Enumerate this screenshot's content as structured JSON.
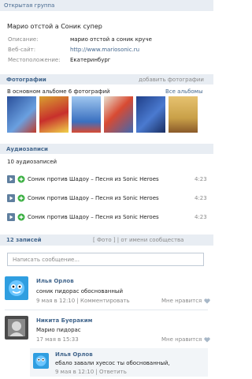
{
  "group_status": "Открытая группа",
  "group_name": "Марио отстой а Соник супер",
  "info": [
    {
      "label": "Описание:",
      "value": "марио отстой а соник круче"
    },
    {
      "label": "Веб-сайт:",
      "value": "http://www.mariosonic.ru"
    },
    {
      "label": "Местоположение:",
      "value": "Екатеринбург"
    }
  ],
  "photos": {
    "header": "Фотографии",
    "add_link": "добавить фотографии",
    "album_caption": "В основном альбоме 6 фотографий",
    "all_albums": "Все альбомы",
    "thumb_labels": [
      "",
      "",
      "",
      "",
      "",
      ""
    ],
    "thumb_colors": [
      "#3a5fa8",
      "#c8302c",
      "#6aa0d8",
      "#d84a32",
      "#2b4f9a",
      "#c9a048"
    ]
  },
  "audio": {
    "header": "Аудиозаписи",
    "count": "10 аудиозаписей",
    "tracks": [
      {
        "title": "Соник против Шадоу – Песня из Sonic Heroes",
        "duration": "4:23"
      },
      {
        "title": "Соник против Шадоу – Песня из Sonic Heroes",
        "duration": "4:23"
      },
      {
        "title": "Соник против Шадоу – Песня из Sonic Heroes",
        "duration": "4:23"
      }
    ]
  },
  "wall": {
    "count": "12 записей",
    "options": "[ Фото ] | от имени сообщества",
    "input_placeholder": "Написать сообщение..."
  },
  "posts": [
    {
      "author": "Илья Орлов",
      "text": "соник пидорас обоснованный",
      "meta": "9 мая в 12:10 | Комментировать",
      "like": "Мне нравится",
      "avatar_color": "#2f9ee0"
    },
    {
      "author": "Никита Буераким",
      "text": "Марио пидорас",
      "meta": "17 мая в 15:33",
      "like": "Мне нравится",
      "avatar_color": "#4a4a4a"
    }
  ],
  "reply": {
    "author": "Илья Орлов",
    "text": "ебало завали хуесос ты обоснованный,",
    "meta": "9 мая в 12:10 | Ответить"
  },
  "colors": {
    "accent": "#45688e",
    "bar_bg": "#e8edf3",
    "play": "#5f7f9f",
    "add": "#3cb043"
  }
}
